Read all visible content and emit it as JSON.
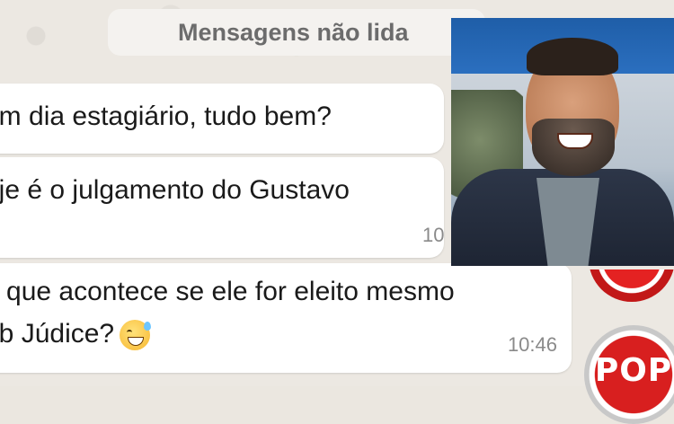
{
  "header": {
    "unread_label": "Mensagens não lida"
  },
  "messages": [
    {
      "text": "om dia estagiário, tudo bem?"
    },
    {
      "text": "oje é o julgamento do Gustavo",
      "time": "10"
    },
    {
      "line1": "o que acontece se ele for eleito mesmo",
      "line2": "ub Júdice?",
      "emoji": "sweat-smile-emoji",
      "time": "10:46"
    }
  ],
  "overlay": {
    "badge_text": "POP",
    "photo": "man-with-beard-photo"
  },
  "colors": {
    "bubble": "#ffffff",
    "background": "#ebe7e0",
    "badge_red": "#d81f1f"
  }
}
